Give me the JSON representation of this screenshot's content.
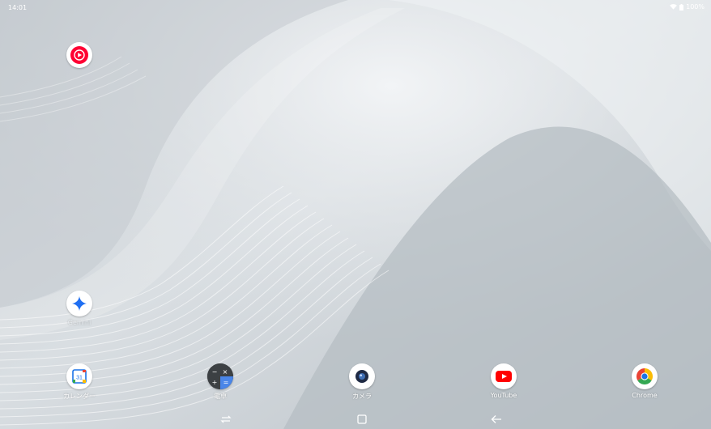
{
  "status_bar": {
    "time": "14:01",
    "battery_text": "100%",
    "icons": [
      "wifi-icon",
      "battery-icon"
    ]
  },
  "apps": {
    "youtube_music": {
      "label": ""
    },
    "gemini": {
      "label": "Gemini"
    },
    "calendar": {
      "label": "カレンダー",
      "icon_text": "31"
    },
    "calculator": {
      "label": "電卓"
    },
    "camera": {
      "label": "カメラ"
    },
    "youtube": {
      "label": "YouTube"
    },
    "chrome": {
      "label": "Chrome"
    }
  },
  "navigation": {
    "buttons": [
      "recents-button",
      "home-button",
      "back-button"
    ]
  },
  "colors": {
    "youtube_red": "#ff0000",
    "calendar_blue": "#1a73e8",
    "chrome_yellow": "#fbbc04",
    "chrome_green": "#34a853",
    "gemini_blue": "#1f6ff2"
  }
}
